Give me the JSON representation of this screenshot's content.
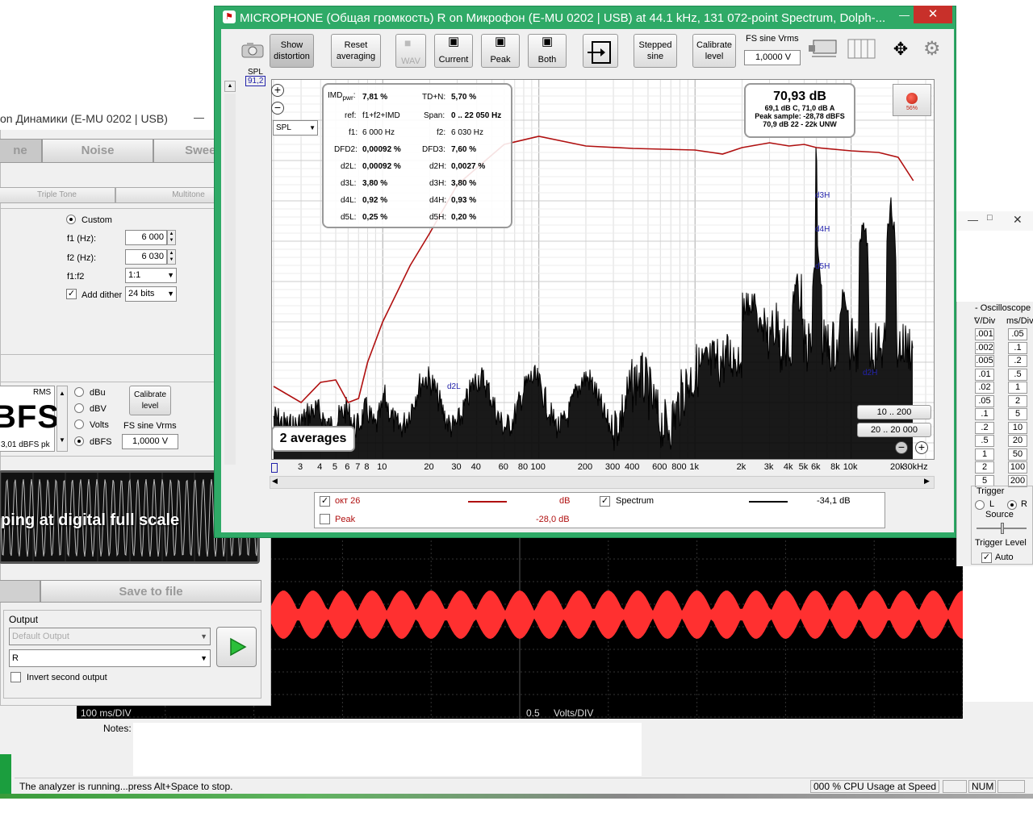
{
  "analyzer": {
    "title": "MICROPHONE (Общая громкость) R on Микрофон (E-MU 0202 | USB) at 44.1 kHz, 131 072-point Spectrum, Dolph-...",
    "toolbar": {
      "show_distortion": "Show distortion",
      "reset_averaging": "Reset averaging",
      "wav": "WAV",
      "current": "Current",
      "peak": "Peak",
      "both": "Both",
      "stepped_sine": "Stepped sine",
      "calibrate_level": "Calibrate level",
      "fs_sine_label": "FS sine Vrms",
      "fs_sine_value": "1,0000 V"
    },
    "spl_label": "SPL",
    "spl_value": "91,2",
    "spl_select": "SPL",
    "imd": {
      "imd_label": "IMD",
      "imd_sub": "pwr",
      "imd_value": "7,81 %",
      "tdn_label": "TD+N:",
      "tdn_value": "5,70 %",
      "ref_label": "ref:",
      "ref_value": "f1+f2+IMD",
      "span_label": "Span:",
      "span_value": "0 .. 22 050 Hz",
      "f1_label": "f1:",
      "f1_value": "6 000 Hz",
      "f2_label": "f2:",
      "f2_value": "6 030 Hz",
      "dfd2_label": "DFD2:",
      "dfd2_value": "0,00092 %",
      "dfd3_label": "DFD3:",
      "dfd3_value": "7,60 %",
      "d2l_label": "d2L:",
      "d2l_value": "0,00092 %",
      "d2h_label": "d2H:",
      "d2h_value": "0,0027 %",
      "d3l_label": "d3L:",
      "d3l_value": "3,80 %",
      "d3h_label": "d3H:",
      "d3h_value": "3,80 %",
      "d4l_label": "d4L:",
      "d4l_value": "0,92 %",
      "d4h_label": "d4H:",
      "d4h_value": "0,93 %",
      "d5l_label": "d5L:",
      "d5l_value": "0,25 %",
      "d5h_label": "d5H:",
      "d5h_value": "0,20 %"
    },
    "level": {
      "main": "70,93 dB",
      "line1": "69,1 dB C, 71,0 dB A",
      "line2": "Peak sample: -28,78 dBFS",
      "line3": "70,9 dB 22 - 22k UNW"
    },
    "rec_percent": "56%",
    "averages": "2 averages",
    "range1": "10 .. 200",
    "range2": "20 .. 20 000",
    "harmonic_labels": [
      "d3H",
      "d4H",
      "d5H",
      "d2H",
      "d2L"
    ],
    "x_ticks": [
      "3",
      "4",
      "5",
      "6",
      "7",
      "8",
      "10",
      "20",
      "30",
      "40",
      "60",
      "80",
      "100",
      "200",
      "300",
      "400",
      "600",
      "800",
      "1k",
      "2k",
      "3k",
      "4k",
      "5k",
      "6k",
      "8k",
      "10k",
      "20k",
      "30kHz"
    ],
    "legend": {
      "r1_name": "окт 26",
      "r1_unit": "dB",
      "r1_color": "#b01010",
      "r2_name": "Peak",
      "r2_value": "-28,0 dB",
      "r2_color": "#b01010",
      "r3_name": "Spectrum",
      "r3_value": "-34,1 dB",
      "r3_color": "#000000"
    }
  },
  "generator": {
    "title": "on Динамики (E-MU 0202 | USB)",
    "tabs": [
      "ne",
      "Noise",
      "Sweeps"
    ],
    "subtabs": [
      "Triple Tone",
      "Multitone"
    ],
    "custom_label": "Custom",
    "f1_label": "f1 (Hz):",
    "f1_value": "6 000",
    "f2_label": "f2 (Hz):",
    "f2_value": "6 030",
    "ratio_label": "f1:f2",
    "ratio_value": "1:1",
    "dither_label": "Add dither",
    "dither_value": "24 bits",
    "rms_label": "RMS",
    "big_level": "BFS",
    "small_level": "3,01 dBFS pk",
    "units": [
      "dBu",
      "dBV",
      "Volts",
      "dBFS"
    ],
    "calibrate_level": "Calibrate level",
    "fs_sine_label": "FS sine Vrms",
    "fs_sine_value": "1,0000 V",
    "clip_text": "ping at digital full scale",
    "save_to_file": "Save to file",
    "output_label": "Output",
    "output_device": "Default Output",
    "output_channel": "R",
    "invert_label": "Invert second output"
  },
  "scope": {
    "timebase": "100  ms/DIV",
    "vdiv_value": "0.5",
    "vdiv_unit": "Volts/DIV"
  },
  "scope_panel": {
    "title": "Oscilloscope",
    "vdiv_header": "V/Div",
    "msdiv_header": "ms/Div",
    "vdiv": [
      ".001",
      ".002",
      ".005",
      ".01",
      ".02",
      ".05",
      ".1",
      ".2",
      ".5",
      "1",
      "2",
      "5"
    ],
    "msdiv": [
      ".05",
      ".1",
      ".2",
      ".5",
      "1",
      "2",
      "5",
      "10",
      "20",
      "50",
      "100",
      "200"
    ],
    "trigger_label": "Trigger",
    "trig_l": "L",
    "trig_r": "R",
    "source_label": "Source",
    "trigger_level_label": "Trigger Level",
    "auto_label": "Auto"
  },
  "main": {
    "notes_label": "Notes:",
    "status_text": "The analyzer is running...press Alt+Space to stop.",
    "cpu_text": "000 % CPU Usage at Speed 00",
    "num_text": "NUM"
  }
}
